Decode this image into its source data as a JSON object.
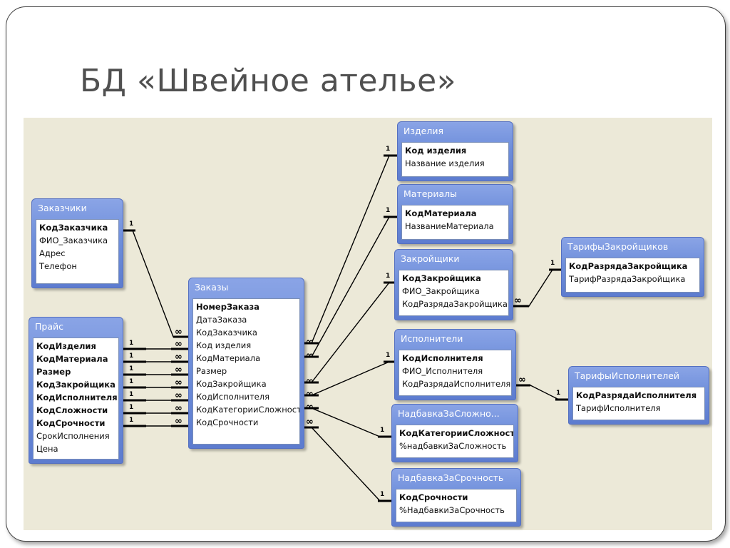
{
  "slide": {
    "title": "БД «Швейное ателье»"
  },
  "tables": {
    "izdelia": {
      "title": "Изделия",
      "fields": [
        {
          "name": "Код изделия",
          "key": true
        },
        {
          "name": "Название изделия",
          "key": false
        }
      ]
    },
    "materialy": {
      "title": "Материалы",
      "fields": [
        {
          "name": "КодМатериала",
          "key": true
        },
        {
          "name": "НазваниеМатериала",
          "key": false
        }
      ]
    },
    "zakazchiki": {
      "title": "Заказчики",
      "fields": [
        {
          "name": "КодЗаказчика",
          "key": true
        },
        {
          "name": "ФИО_Заказчика",
          "key": false
        },
        {
          "name": "Адрес",
          "key": false
        },
        {
          "name": "Телефон",
          "key": false
        }
      ]
    },
    "zakroy": {
      "title": "Закройщики",
      "fields": [
        {
          "name": "КодЗакройщика",
          "key": true
        },
        {
          "name": "ФИО_Закройщика",
          "key": false
        },
        {
          "name": "КодРазрядаЗакройщика",
          "key": false
        }
      ]
    },
    "tarZakr": {
      "title": "ТарифыЗакройщиков",
      "fields": [
        {
          "name": "КодРазрядаЗакройщика",
          "key": true
        },
        {
          "name": "ТарифРазрядаЗакройщика",
          "key": false
        }
      ]
    },
    "zakazy": {
      "title": "Заказы",
      "fields": [
        {
          "name": "НомерЗаказа",
          "key": true
        },
        {
          "name": "ДатаЗаказа",
          "key": false
        },
        {
          "name": "КодЗаказчика",
          "key": false
        },
        {
          "name": "Код изделия",
          "key": false
        },
        {
          "name": "КодМатериала",
          "key": false
        },
        {
          "name": "Размер",
          "key": false
        },
        {
          "name": "КодЗакройщика",
          "key": false
        },
        {
          "name": "КодИсполнителя",
          "key": false
        },
        {
          "name": "КодКатегорииСложности",
          "key": false
        },
        {
          "name": "КодСрочности",
          "key": false
        }
      ]
    },
    "price": {
      "title": "Прайс",
      "fields": [
        {
          "name": "КодИзделия",
          "key": true
        },
        {
          "name": "КодМатериала",
          "key": true
        },
        {
          "name": "Размер",
          "key": true
        },
        {
          "name": "КодЗакройщика",
          "key": true
        },
        {
          "name": "КодИсполнителя",
          "key": true
        },
        {
          "name": "КодСложности",
          "key": true
        },
        {
          "name": "КодСрочности",
          "key": true
        },
        {
          "name": "СрокИсполнения",
          "key": false
        },
        {
          "name": "Цена",
          "key": false
        }
      ]
    },
    "ispoln": {
      "title": "Исполнители",
      "fields": [
        {
          "name": "КодИсполнителя",
          "key": true
        },
        {
          "name": "ФИО_Исполнителя",
          "key": false
        },
        {
          "name": "КодРазрядаИсполнителя",
          "key": false
        }
      ]
    },
    "tarIsp": {
      "title": "ТарифыИсполнителей",
      "fields": [
        {
          "name": "КодРазрядаИсполнителя",
          "key": true
        },
        {
          "name": "ТарифИсполнителя",
          "key": false
        }
      ]
    },
    "nadSlozh": {
      "title": "НадбавкаЗаСложно...",
      "fields": [
        {
          "name": "КодКатегорииСложности",
          "key": true
        },
        {
          "name": "%надбавкиЗаСложность",
          "key": false
        }
      ]
    },
    "nadSroch": {
      "title": "НадбавкаЗаСрочность",
      "fields": [
        {
          "name": "КодСрочности",
          "key": true
        },
        {
          "name": "%НадбавкиЗаСрочность",
          "key": false
        }
      ]
    }
  },
  "relations": {
    "one_label": "1",
    "many_label": "∞"
  }
}
